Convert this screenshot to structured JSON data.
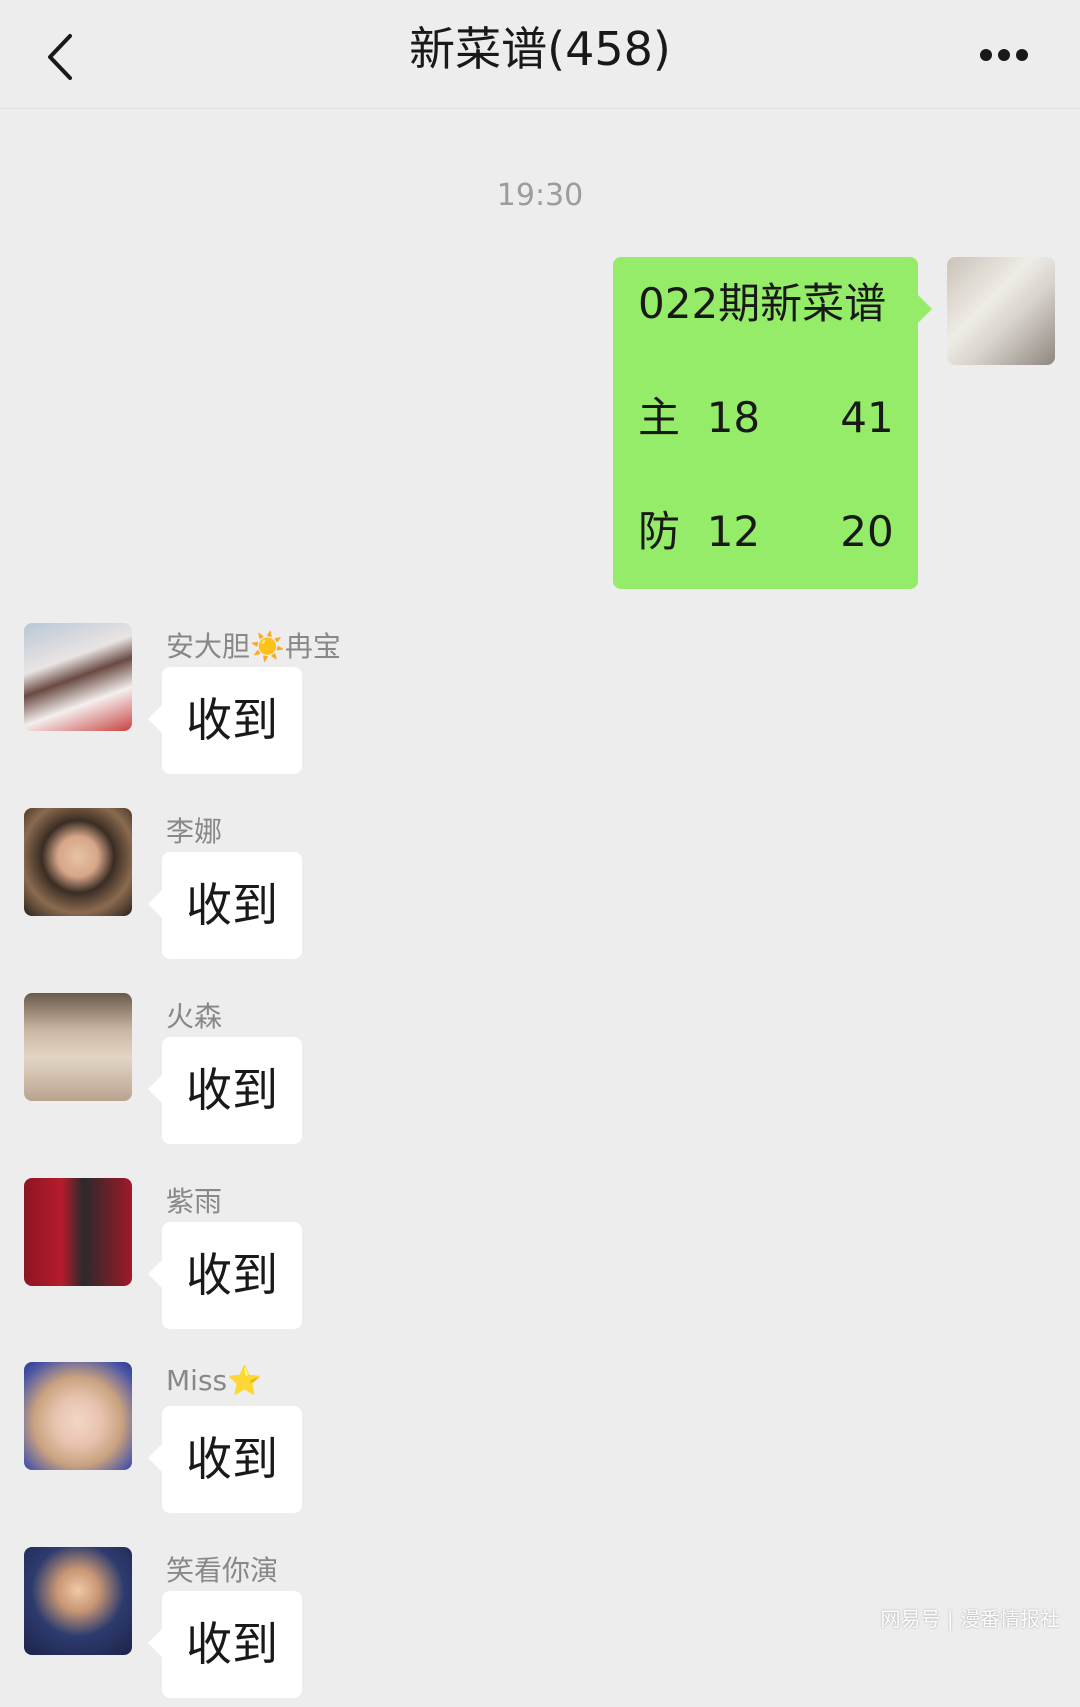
{
  "header": {
    "back_icon": "chevron-left-icon",
    "title": "新菜谱(458)",
    "more_icon": "more-dots-icon"
  },
  "timestamp": "19:30",
  "sent_message": {
    "lines": [
      "022期新菜谱",
      "主  18      41",
      "防  12      20"
    ],
    "bubble_color": "#95ec69"
  },
  "messages": [
    {
      "sender": "安大胆☀️冉宝",
      "text": "收到"
    },
    {
      "sender": "李娜",
      "text": "收到"
    },
    {
      "sender": "火森",
      "text": "收到"
    },
    {
      "sender": "紫雨",
      "text": "收到"
    },
    {
      "sender": "Miss⭐",
      "text": "收到"
    },
    {
      "sender": "笑看你演",
      "text": "收到"
    }
  ],
  "watermark": "网易号 | 漫番情报社"
}
